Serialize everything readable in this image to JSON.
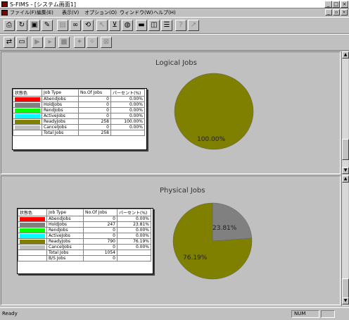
{
  "window": {
    "title": "S-FIMS - [システム画面1]",
    "minimize_glyph": "_",
    "maximize_glyph": "□",
    "close_glyph": "×"
  },
  "menu": [
    "ファイル(F)",
    "編集(E)",
    "表示(V)",
    "オプション(O)",
    "ウィンドウ(W)",
    "ヘルプ(H)"
  ],
  "toolbar1": [
    "printer-icon",
    "refresh-icon",
    "save-icon",
    "paint-icon",
    "clipboard-icon",
    "binoculars-icon",
    "cycle-icon",
    "pointer-icon",
    "filter-icon",
    "globe-icon",
    "layout-split-h-icon",
    "layout-split-v-icon",
    "layout-grid-icon",
    "help-icon",
    "context-help-icon"
  ],
  "toolbar2": [
    "print-setup-icon",
    "preview-icon",
    "play-icon",
    "forward-icon",
    "stop-icon",
    "pin-icon",
    "pin2-icon",
    "clear-icon"
  ],
  "colors": {
    "red": "#ff0000",
    "gray": "#808080",
    "green": "#00ff00",
    "cyan": "#00ffff",
    "olive": "#808000",
    "silver": "#c0c0c0"
  },
  "logical": {
    "title": "Logical Jobs",
    "headers": [
      "状態色",
      "Job Type",
      "No.Of Jobs",
      "パーセント(%)"
    ],
    "rows": [
      {
        "color": "#ff0000",
        "type": "AbendJobs",
        "count": "0",
        "pct": "0.00%"
      },
      {
        "color": "#808080",
        "type": "HoldJobs",
        "count": "0",
        "pct": "0.00%"
      },
      {
        "color": "#00ff00",
        "type": "RendJobs",
        "count": "0",
        "pct": "0.00%"
      },
      {
        "color": "#00ffff",
        "type": "ActiveJobs",
        "count": "0",
        "pct": "0.00%"
      },
      {
        "color": "#808000",
        "type": "ReadyJobs",
        "count": "258",
        "pct": "100.00%"
      },
      {
        "color": "#c0c0c0",
        "type": "CancelJobs",
        "count": "0",
        "pct": "0.00%"
      }
    ],
    "total_label": "Total Jobs",
    "total_count": "258",
    "pie_label": "100.00%",
    "chart_data": {
      "type": "pie",
      "title": "Logical Jobs",
      "categories": [
        "AbendJobs",
        "HoldJobs",
        "RendJobs",
        "ActiveJobs",
        "ReadyJobs",
        "CancelJobs"
      ],
      "values": [
        0,
        0,
        0,
        0,
        258,
        0
      ]
    }
  },
  "physical": {
    "title": "Physical Jobs",
    "headers": [
      "状態色",
      "Job Type",
      "No.Of Jobs",
      "パーセント(%)"
    ],
    "rows": [
      {
        "color": "#ff0000",
        "type": "AbendJobs",
        "count": "0",
        "pct": "0.00%"
      },
      {
        "color": "#808080",
        "type": "HoldJobs",
        "count": "247",
        "pct": "23.81%"
      },
      {
        "color": "#00ff00",
        "type": "RendJobs",
        "count": "0",
        "pct": "0.00%"
      },
      {
        "color": "#00ffff",
        "type": "ActiveJobs",
        "count": "0",
        "pct": "0.00%"
      },
      {
        "color": "#808000",
        "type": "ReadyJobs",
        "count": "790",
        "pct": "76.19%"
      },
      {
        "color": "#c0c0c0",
        "type": "CancelJobs",
        "count": "0",
        "pct": "0.00%"
      }
    ],
    "total_label": "Total Jobs",
    "total_count": "1054",
    "extra_label": "B/S Jobs",
    "extra_count": "0",
    "pie_labels": [
      "23.81%",
      "76.19%"
    ],
    "chart_data": {
      "type": "pie",
      "title": "Physical Jobs",
      "categories": [
        "AbendJobs",
        "HoldJobs",
        "RendJobs",
        "ActiveJobs",
        "ReadyJobs",
        "CancelJobs"
      ],
      "values": [
        0,
        247,
        0,
        0,
        790,
        0
      ]
    }
  },
  "status": {
    "text": "Ready",
    "panel2": "NUM"
  }
}
